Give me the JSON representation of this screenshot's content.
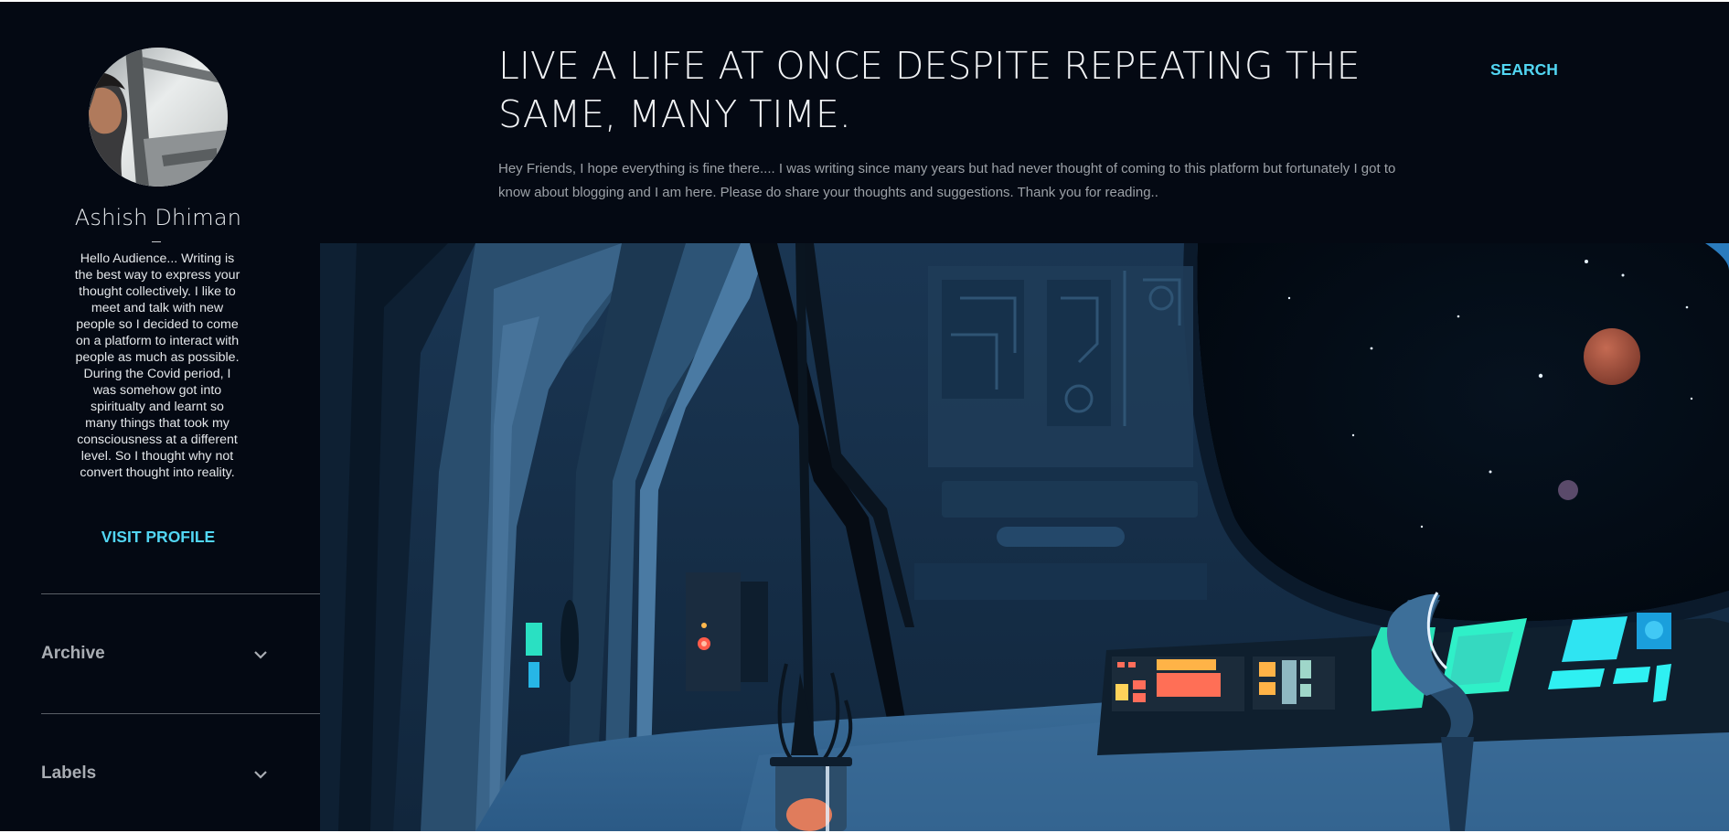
{
  "profile": {
    "name": "Ashish Dhiman",
    "bio": "Hello Audience... Writing is the best way to express your thought collectively. I like to meet and talk with new people so I decided to come on a platform to interact with people as much as possible. During the Covid period, I was somehow got into spiritualty and learnt so many things that took my consciousness at a different level. So I thought why not convert thought into reality.",
    "visit_label": "VISIT PROFILE",
    "avatar_icon": "person-in-car-photo"
  },
  "sidebar": {
    "sections": [
      {
        "label": "Archive",
        "icon": "chevron-down-icon"
      },
      {
        "label": "Labels",
        "icon": "chevron-down-icon"
      }
    ]
  },
  "header": {
    "title": "LIVE A LIFE AT ONCE DESPITE REPEATING THE SAME, MANY TIME.",
    "description": "Hey Friends, I hope everything is fine there.... I was writing since many years but had never thought of coming to this platform but fortunately I got to know about blogging and I am here. Please do share your thoughts and suggestions. Thank you for reading..",
    "search_label": "SEARCH"
  },
  "hero": {
    "image": "spaceship-interior-illustration"
  },
  "colors": {
    "background": "#040913",
    "accent": "#52d6f3",
    "heading": "#f1f3f5",
    "muted": "#9ca1a7",
    "section_label": "#a9adb3"
  }
}
